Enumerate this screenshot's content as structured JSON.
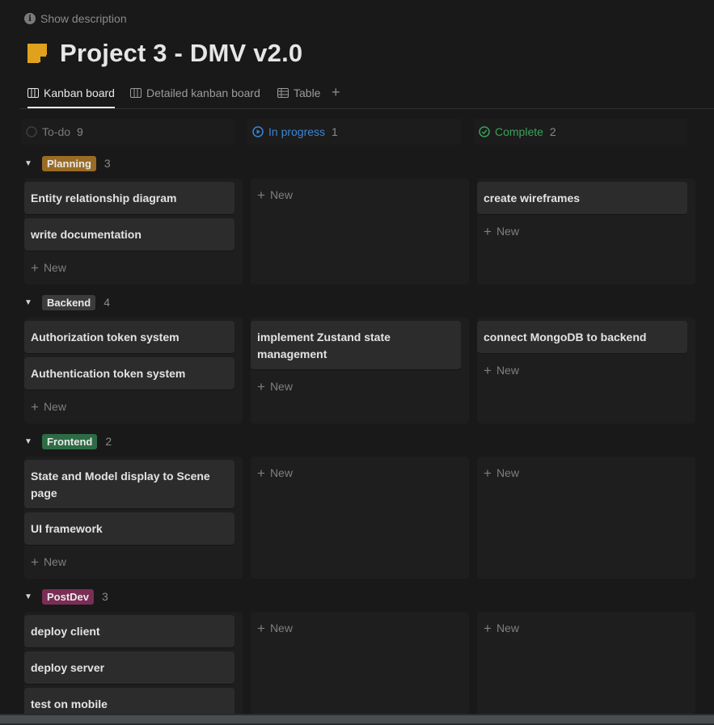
{
  "header": {
    "show_description": "Show description",
    "title": "Project 3 - DMV v2.0",
    "page_icon_color": "#E0A21C"
  },
  "tabs": [
    {
      "label": "Kanban board",
      "active": true,
      "icon": "board-icon"
    },
    {
      "label": "Detailed kanban board",
      "active": false,
      "icon": "board-icon"
    },
    {
      "label": "Table",
      "active": false,
      "icon": "table-icon"
    }
  ],
  "columns": [
    {
      "label": "To-do",
      "count": "9",
      "color": "#8a8a8a",
      "icon": "circle-outline-icon"
    },
    {
      "label": "In progress",
      "count": "1",
      "color": "#3a86d6",
      "icon": "play-circle-icon"
    },
    {
      "label": "Complete",
      "count": "2",
      "color": "#3aa15a",
      "icon": "check-circle-icon"
    }
  ],
  "new_label": "New",
  "groups": [
    {
      "name": "Planning",
      "count": "3",
      "tag_color": "#9a6b24",
      "todo": [
        "Entity relationship diagram",
        "write documentation"
      ],
      "in_progress": [],
      "complete": [
        "create wireframes"
      ]
    },
    {
      "name": "Backend",
      "count": "4",
      "tag_color": "#3b3b3b",
      "todo": [
        "Authorization token system",
        "Authentication token system"
      ],
      "in_progress": [
        "implement Zustand state management"
      ],
      "complete": [
        "connect MongoDB to backend"
      ]
    },
    {
      "name": "Frontend",
      "count": "2",
      "tag_color": "#2e6b45",
      "todo": [
        "State and Model display to Scene page",
        "UI framework"
      ],
      "in_progress": [],
      "complete": []
    },
    {
      "name": "PostDev",
      "count": "3",
      "tag_color": "#7a2e55",
      "todo": [
        "deploy client",
        "deploy server",
        "test on mobile"
      ],
      "in_progress": [],
      "complete": []
    }
  ]
}
